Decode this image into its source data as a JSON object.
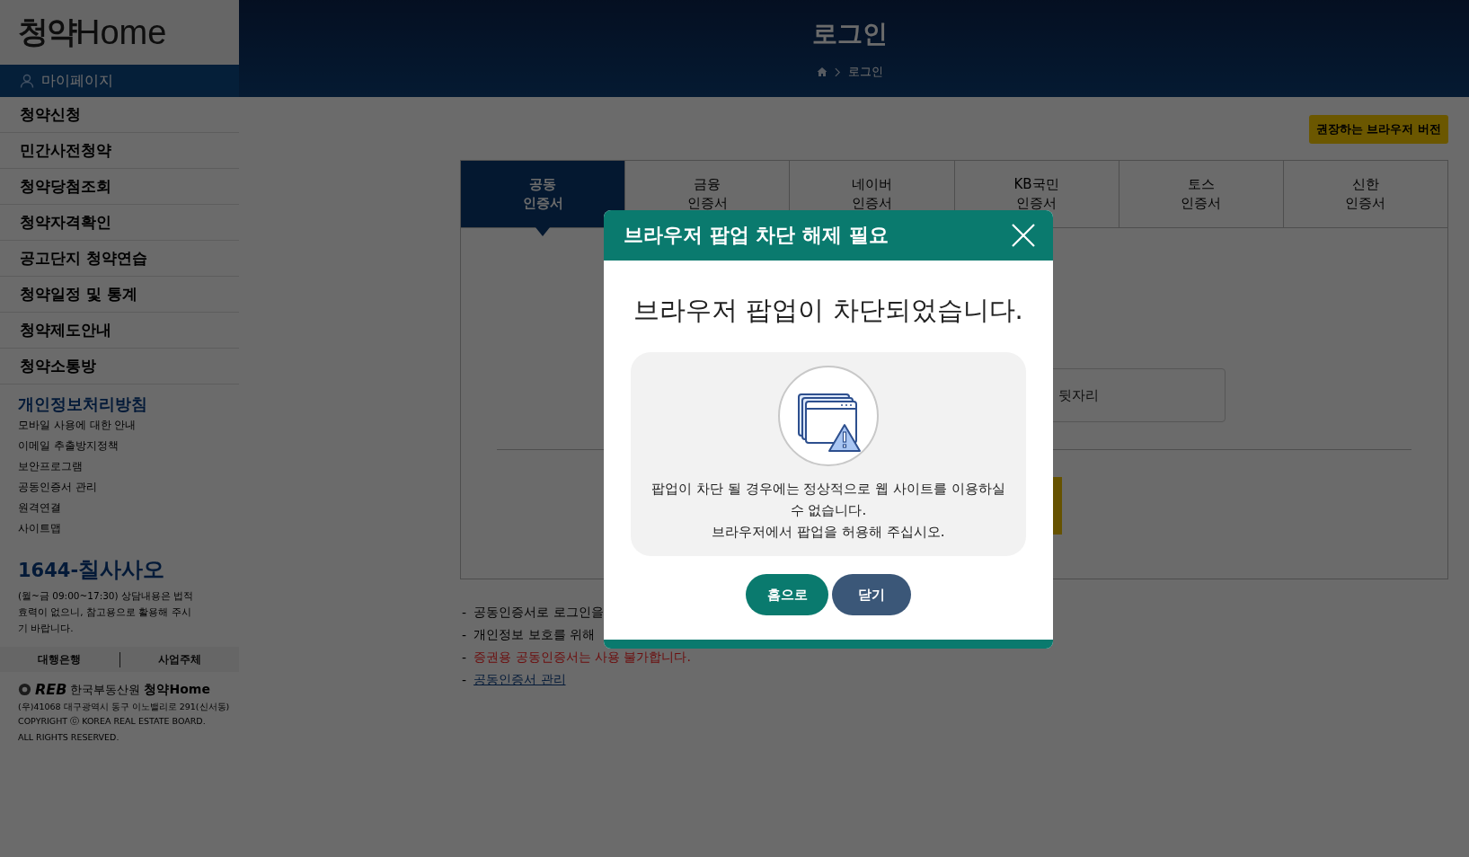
{
  "logo": {
    "ko": "청약",
    "en": "Home"
  },
  "sidebar": {
    "mypage": "마이페이지",
    "menu": [
      "청약신청",
      "민간사전청약",
      "청약당첨조회",
      "청약자격확인",
      "공고단지 청약연습",
      "청약일정 및 통계",
      "청약제도안내",
      "청약소통방"
    ],
    "privacy": "개인정보처리방침",
    "links": [
      "모바일 사용에 대한 안내",
      "이메일 추출방지정책",
      "보안프로그램",
      "공동인증서 관리",
      "원격연결",
      "사이트맵"
    ],
    "phone_prefix": "1644-",
    "phone_words": "칠사사오",
    "hours_note": "(월~금 09:00~17:30) 상담내용은 법적효력이 없으니, 참고용으로 활용해 주시기 바랍니다.",
    "footer_tabs": [
      "대행은행",
      "사업주체"
    ],
    "org": {
      "reb": "REB",
      "name": "한국부동산원",
      "logo_ko": "청약",
      "logo_en": "Home"
    },
    "address": "(우)41068 대구광역시 동구 이노밸리로 291(신서동)",
    "copyright": "COPYRIGHT ⓒ KOREA REAL ESTATE BOARD. ALL RIGHTS RESERVED."
  },
  "header": {
    "title": "로그인",
    "breadcrumb": "로그인"
  },
  "browser_button": "권장하는 브라우저 버전",
  "cert_tabs": [
    {
      "lines": [
        "공동",
        "인증서"
      ],
      "selected": true
    },
    {
      "lines": [
        "금융",
        "인증서"
      ],
      "selected": false
    },
    {
      "lines": [
        "네이버",
        "인증서"
      ],
      "selected": false
    },
    {
      "lines": [
        "KB국민",
        "인증서"
      ],
      "selected": false
    },
    {
      "lines": [
        "토스",
        "인증서"
      ],
      "selected": false
    },
    {
      "lines": [
        "신한",
        "인증서"
      ],
      "selected": false
    }
  ],
  "login_form": {
    "field": {
      "placeholder": "뒷자리"
    }
  },
  "notes": [
    {
      "bullet": "-",
      "text": "공동인증서로 로그인을",
      "kind": "plain"
    },
    {
      "bullet": "-",
      "text": "개인정보 보호를 위해",
      "kind": "plain"
    },
    {
      "bullet": "-",
      "text": "증권용 공동인증서는 사용 불가합니다.",
      "kind": "warning"
    },
    {
      "bullet": "-",
      "text": "공동인증서 관리",
      "kind": "link"
    }
  ],
  "modal": {
    "title": "브라우저 팝업 차단 해제 필요",
    "heading": "브라우저 팝업이 차단되었습니다.",
    "message_lines": [
      "팝업이 차단 될 경우에는 정상적으로 웹 사이트를 이용하실 수 없습니다.",
      "브라우저에서 팝업을 허용해 주십시오."
    ],
    "buttons": [
      {
        "label": "홈으로",
        "kind": "primary"
      },
      {
        "label": "닫기",
        "kind": "secondary"
      }
    ]
  }
}
